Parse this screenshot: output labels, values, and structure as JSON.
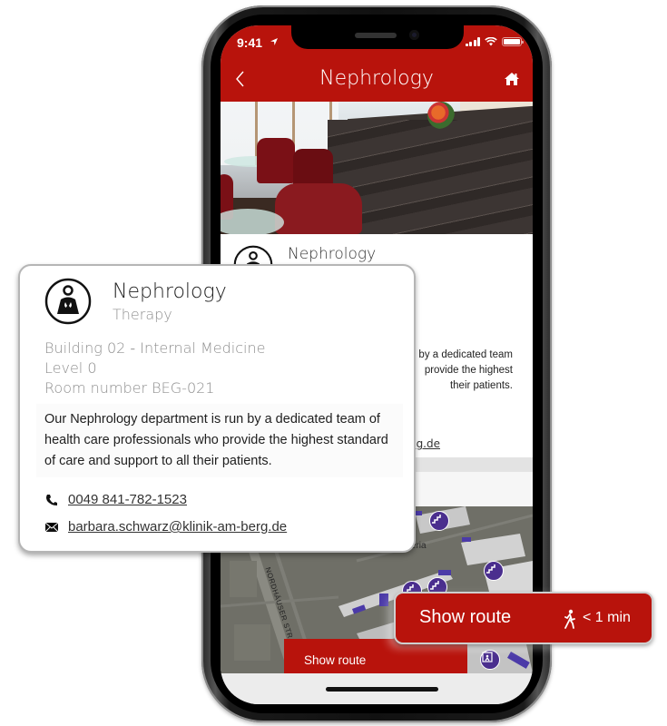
{
  "status_bar": {
    "time": "9:41",
    "battery_level": 1.0
  },
  "nav": {
    "title": "Nephrology",
    "back_icon": "chevron-left-icon",
    "home_icon": "home-icon"
  },
  "screen_card": {
    "title": "Nephrology",
    "description_fragments": [
      "by a dedicated team",
      "provide the highest",
      "their patients."
    ],
    "email_fragment": "g.de"
  },
  "map": {
    "street_label": "NORDHÄUSER STR.",
    "poi_label": "Cafeteria",
    "poi_icons": [
      "stairs-icon",
      "stairs-icon",
      "stairs-icon",
      "stairs-icon",
      "stairs-icon",
      "stairs-icon",
      "elevator-icon"
    ],
    "marker_icon": "location-pin-icon"
  },
  "screen_route_button": {
    "label": "Show route"
  },
  "info_card": {
    "icon": "nephrology-person-icon",
    "title": "Nephrology",
    "subtitle": "Therapy",
    "building": "Building 02",
    "building_separator": " - ",
    "department": "Internal Medicine",
    "level": "Level 0",
    "room": "Room number BEG-021",
    "description": "Our Nephrology department is run by a dedicated team of health care professionals who provide the highest standard of care and support to all their patients.",
    "phone": "0049 841-782-1523",
    "email": "barbara.schwarz@klinik-am-berg.de"
  },
  "route_overlay": {
    "label": "Show route",
    "walk_icon": "walking-person-icon",
    "duration": "< 1 min"
  },
  "colors": {
    "brand_red": "#b8130c",
    "poi_purple": "#4a2e8e",
    "pin_red": "#e8130f"
  }
}
